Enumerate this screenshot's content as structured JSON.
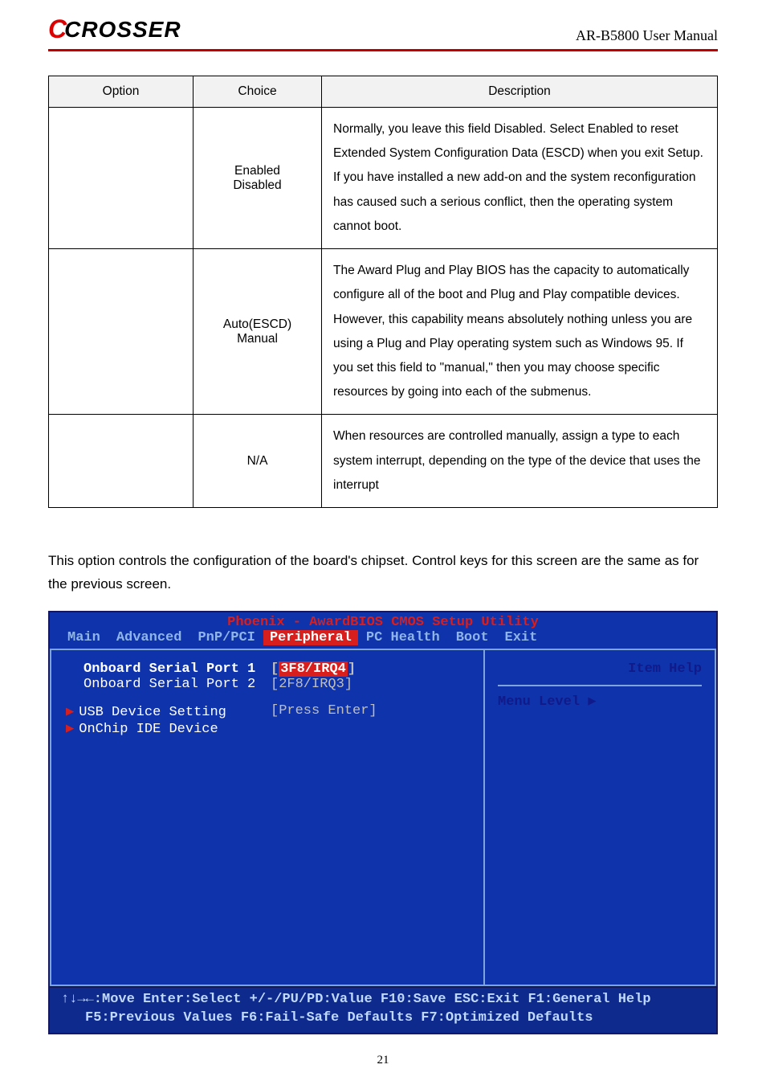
{
  "header": {
    "logo_c": "C",
    "logo_rest": "CROSSER",
    "doc_title": "AR-B5800 User Manual"
  },
  "table": {
    "headers": {
      "option": "Option",
      "choice": "Choice",
      "description": "Description"
    },
    "rows": [
      {
        "choice_line1": "Enabled",
        "choice_line2": "Disabled",
        "desc": "Normally, you leave this field Disabled. Select Enabled to reset Extended System Configuration Data (ESCD) when you exit Setup. If you have installed a new add-on and the system reconfiguration has caused such a serious conflict, then the operating system cannot boot."
      },
      {
        "choice_line1": "Auto(ESCD)",
        "choice_line2": "Manual",
        "desc": "The Award Plug and Play BIOS has the capacity to automatically configure all of the boot and Plug and Play compatible devices. However, this capability means absolutely nothing unless you are using a Plug and Play operating system such as Windows 95. If you set this field to \"manual,\" then you may choose specific resources by going into each of the submenus."
      },
      {
        "choice_line1": "N/A",
        "choice_line2": "",
        "desc": "When resources are controlled manually, assign a type to each system interrupt, depending on the type of the device that uses the interrupt"
      }
    ]
  },
  "paragraph": "This option controls the configuration of the board's chipset. Control keys for this screen are the same as for the previous screen.",
  "bios": {
    "title": "Phoenix - AwardBIOS CMOS Setup Utility",
    "menu": [
      "Main",
      "Advanced",
      "PnP/PCI",
      "Peripheral",
      "PC Health",
      "Boot",
      "Exit"
    ],
    "active_menu_index": 3,
    "left": {
      "serial1_label": "Onboard Serial Port 1",
      "serial1_val_open": "[",
      "serial1_val": "3F8/IRQ4",
      "serial1_val_close": "]",
      "serial2_label": "Onboard Serial Port 2",
      "serial2_val": "[2F8/IRQ3]",
      "usb_label": "USB Device Setting",
      "usb_val": "[Press Enter]",
      "ide_label": "OnChip IDE Device"
    },
    "right": {
      "item_help": "Item Help",
      "menu_level": "Menu Level   ▶"
    },
    "footer_line1": "↑↓→←:Move  Enter:Select  +/-/PU/PD:Value  F10:Save  ESC:Exit  F1:General Help",
    "footer_line2": "F5:Previous Values    F6:Fail-Safe Defaults    F7:Optimized Defaults"
  },
  "page_number": "21",
  "chart_data": {
    "type": "table",
    "columns": [
      "Option",
      "Choice",
      "Description"
    ],
    "rows": [
      [
        "",
        "Enabled / Disabled",
        "Normally, you leave this field Disabled. Select Enabled to reset Extended System Configuration Data (ESCD) when you exit Setup. If you have installed a new add-on and the system reconfiguration has caused such a serious conflict, then the operating system cannot boot."
      ],
      [
        "",
        "Auto(ESCD) / Manual",
        "The Award Plug and Play BIOS has the capacity to automatically configure all of the boot and Plug and Play compatible devices. However, this capability means absolutely nothing unless you are using a Plug and Play operating system such as Windows 95. If you set this field to \"manual,\" then you may choose specific resources by going into each of the submenus."
      ],
      [
        "",
        "N/A",
        "When resources are controlled manually, assign a type to each system interrupt, depending on the type of the device that uses the interrupt"
      ]
    ]
  }
}
